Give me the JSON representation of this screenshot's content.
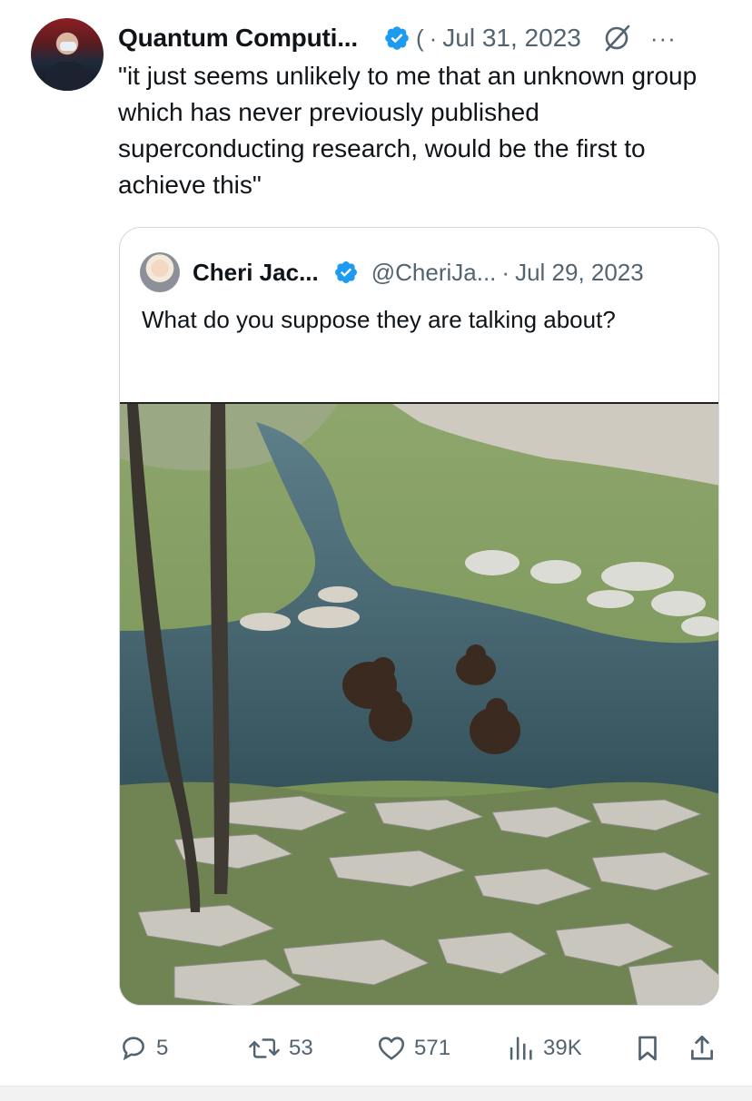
{
  "tweet": {
    "author": "Quantum Computi...",
    "handle_glyph": "(",
    "dot": "·",
    "date": "Jul 31, 2023",
    "more": "···",
    "text": "\"it just seems unlikely to me that an unknown group which has never previously published superconducting research, would be the first to achieve this\""
  },
  "quote": {
    "author": "Cheri Jac...",
    "handle": "@CheriJa...",
    "dot": "·",
    "date": "Jul 29, 2023",
    "text": "What do you suppose they are talking about?",
    "image_description_icon": "photo-bears-in-river"
  },
  "actions": {
    "replies": "5",
    "retweets": "53",
    "likes": "571",
    "views": "39K"
  },
  "colors": {
    "verified": "#1d9bf0",
    "secondary_text": "#536471",
    "border": "#cfd9de"
  }
}
